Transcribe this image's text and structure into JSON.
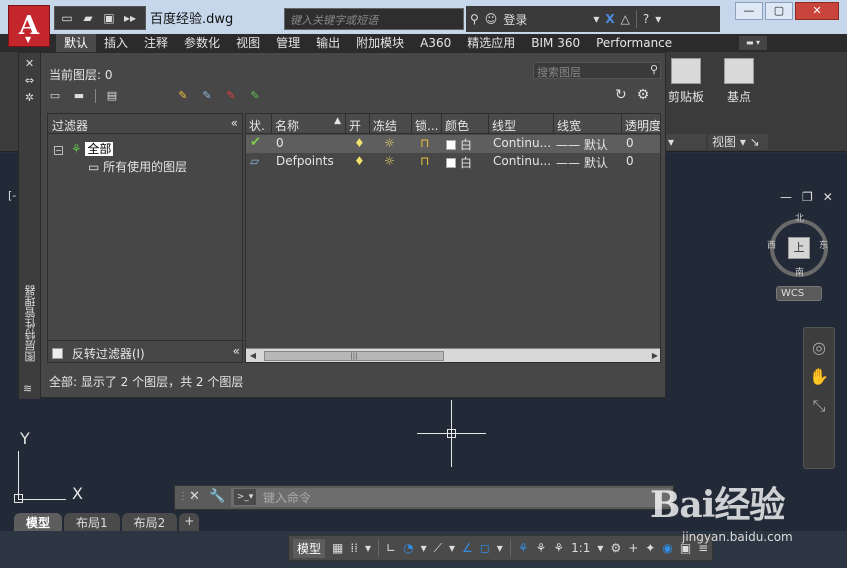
{
  "title_bar": {
    "document_title": "百度经验.dwg",
    "search_placeholder": "键入关键字或短语",
    "login_label": "登录"
  },
  "ribbon": {
    "tabs": [
      "默认",
      "插入",
      "注释",
      "参数化",
      "视图",
      "管理",
      "输出",
      "附加模块",
      "A360",
      "精选应用",
      "BIM 360",
      "Performance"
    ],
    "active_tab": "默认",
    "clipboard_label": "剪贴板",
    "base_label": "基点",
    "view_panel_label": "视图"
  },
  "layer_manager": {
    "vertical_title": "图层特性管理器",
    "current_layer": "当前图层: 0",
    "search_placeholder": "搜索图层",
    "filters": {
      "header": "过滤器",
      "tree_all": "全部",
      "tree_used": "所有使用的图层",
      "invert_label": "反转过滤器(I)"
    },
    "columns": [
      "状.",
      "名称",
      "开",
      "冻结",
      "锁...",
      "颜色",
      "线型",
      "线宽",
      "透明度"
    ],
    "rows": [
      {
        "name": "0",
        "color": "白",
        "linetype": "Continu...",
        "lineweight": "—— 默认",
        "transparency": "0"
      },
      {
        "name": "Defpoints",
        "color": "白",
        "linetype": "Continu...",
        "lineweight": "—— 默认",
        "transparency": "0"
      }
    ],
    "status_text": "全部: 显示了 2 个图层，共 2 个图层"
  },
  "viewcube": {
    "face": "上",
    "north": "北",
    "south": "南",
    "east": "东",
    "west": "西",
    "wcs_label": "WCS"
  },
  "viewport_label": "[-",
  "ucs": {
    "x": "X",
    "y": "Y"
  },
  "command_line": {
    "placeholder": "键入命令"
  },
  "layout_tabs": [
    "模型",
    "布局1",
    "布局2"
  ],
  "status_bar": {
    "model_label": "模型",
    "scale": "1:1"
  },
  "watermark": {
    "brand": "Bai经验",
    "url": "jingyan.baidu.com"
  },
  "colors": {
    "app_red": "#c4262e",
    "drawing_bg": "#212a36",
    "palette_bg": "#474747",
    "accent_blue": "#2f8ee5"
  }
}
